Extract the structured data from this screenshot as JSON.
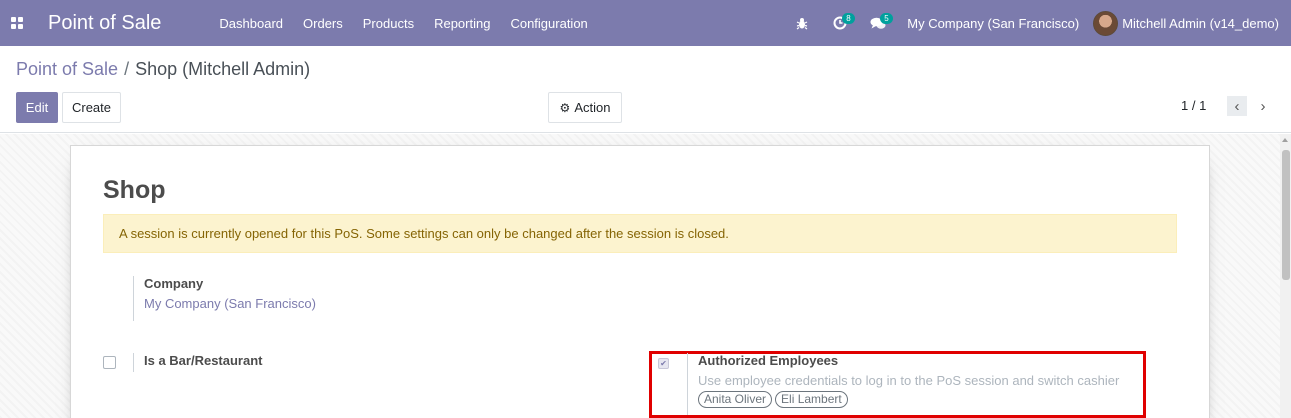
{
  "navbar": {
    "brand": "Point of Sale",
    "menu": [
      "Dashboard",
      "Orders",
      "Products",
      "Reporting",
      "Configuration"
    ],
    "activity_count": "8",
    "messages_count": "5",
    "company": "My Company (San Francisco)",
    "user": "Mitchell Admin (v14_demo)",
    "icons": [
      "apps-icon",
      "bug-icon",
      "clock-icon",
      "chat-icon",
      "avatar"
    ]
  },
  "breadcrumb": {
    "parent": "Point of Sale",
    "separator": "/",
    "current": "Shop (Mitchell Admin)"
  },
  "buttons": {
    "edit": "Edit",
    "create": "Create",
    "action": "Action"
  },
  "pager": {
    "value": "1 / 1"
  },
  "form": {
    "title": "Shop",
    "alert": "A session is currently opened for this PoS. Some settings can only be changed after the session is closed.",
    "company_label": "Company",
    "company_value": "My Company (San Francisco)",
    "bar_label": "Is a Bar/Restaurant",
    "bar_checked": false,
    "auth_label": "Authorized Employees",
    "auth_checked": true,
    "auth_desc": "Use employee credentials to log in to the PoS session and switch cashier",
    "employees": [
      "Anita Oliver",
      "Eli Lambert"
    ]
  },
  "colors": {
    "brand": "#7c7bad",
    "badge": "#00a09d",
    "alert_bg": "#fcf3cf",
    "highlight": "#e00000"
  }
}
